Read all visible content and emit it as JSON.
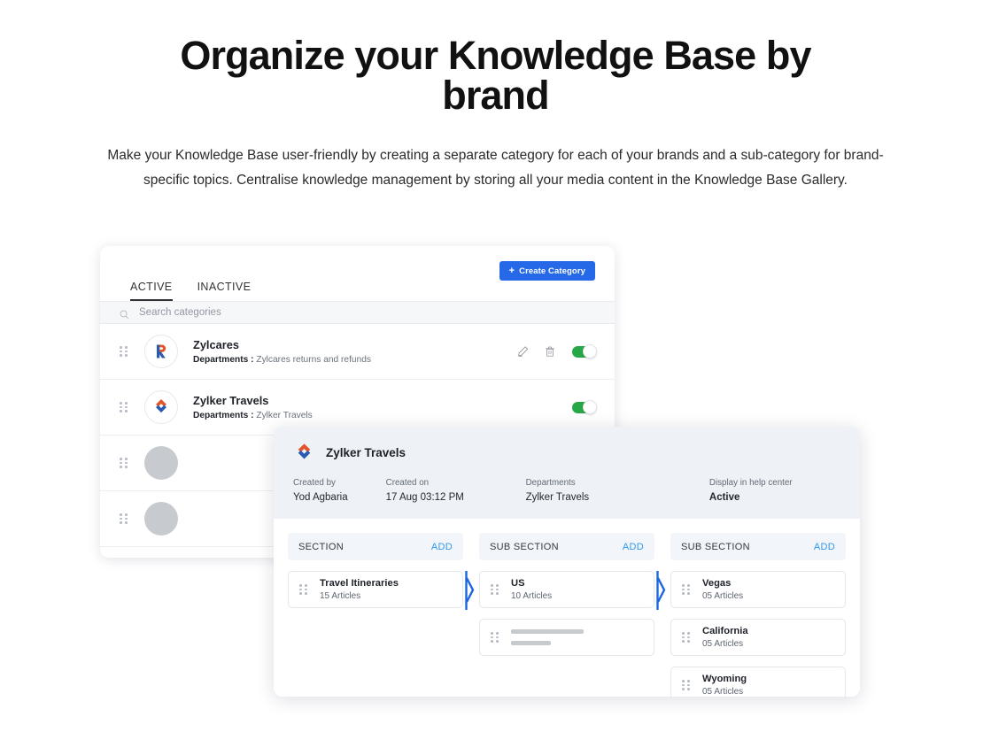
{
  "hero": {
    "title": "Organize your Knowledge Base by brand",
    "subtitle": "Make your Knowledge Base user-friendly by creating a separate category for each of your brands and a sub-category for brand-specific topics. Centralise knowledge management by storing all your media content in the Knowledge Base Gallery."
  },
  "colors": {
    "primary_blue": "#2568e8",
    "link_blue": "#2f9aec",
    "toggle_green": "#27a745",
    "logo_orange": "#e2552c",
    "logo_blue": "#2b5bb0",
    "panel_header": "#eef2f7"
  },
  "category_card": {
    "create_button": {
      "label": "Create Category",
      "plus": "+"
    },
    "tabs": [
      {
        "label": "ACTIVE",
        "active": true
      },
      {
        "label": "INACTIVE",
        "active": false
      }
    ],
    "search": {
      "placeholder": "Search categories",
      "icon": "search-icon"
    },
    "rows": [
      {
        "name": "Zylcares",
        "dept_label": "Departments :",
        "dept_value": "Zylcares returns and refunds",
        "logo": "zylcares-r-logo",
        "actions": [
          "edit-icon",
          "delete-icon"
        ],
        "toggle_on": true,
        "skeleton": false
      },
      {
        "name": "Zylker Travels",
        "dept_label": "Departments :",
        "dept_value": "Zylker Travels",
        "logo": "zylker-travels-logo",
        "actions": [],
        "toggle_on": true,
        "skeleton": false
      },
      {
        "skeleton": true
      },
      {
        "skeleton": true
      }
    ]
  },
  "detail_panel": {
    "title": "Zylker Travels",
    "logo": "zylker-travels-logo",
    "fields": [
      {
        "label": "Created by",
        "value": "Yod Agbaria",
        "bold": false
      },
      {
        "label": "Created on",
        "value": "17 Aug 03:12 PM",
        "bold": false
      },
      {
        "label": "Departments",
        "value": "Zylker Travels",
        "bold": false
      },
      {
        "label": "Display in help center",
        "value": "Active",
        "bold": true
      }
    ],
    "columns": [
      {
        "header": "SECTION",
        "add_label": "ADD",
        "items": [
          {
            "name": "Travel Itineraries",
            "count": "15 Articles",
            "skeleton": false
          }
        ]
      },
      {
        "header": "SUB SECTION",
        "add_label": "ADD",
        "items": [
          {
            "name": "US",
            "count": "10 Articles",
            "skeleton": false
          },
          {
            "skeleton": true
          }
        ]
      },
      {
        "header": "SUB SECTION",
        "add_label": "ADD",
        "items": [
          {
            "name": "Vegas",
            "count": "05 Articles",
            "skeleton": false
          },
          {
            "name": "California",
            "count": "05 Articles",
            "skeleton": false
          },
          {
            "name": "Wyoming",
            "count": "05 Articles",
            "skeleton": false
          }
        ]
      }
    ]
  }
}
